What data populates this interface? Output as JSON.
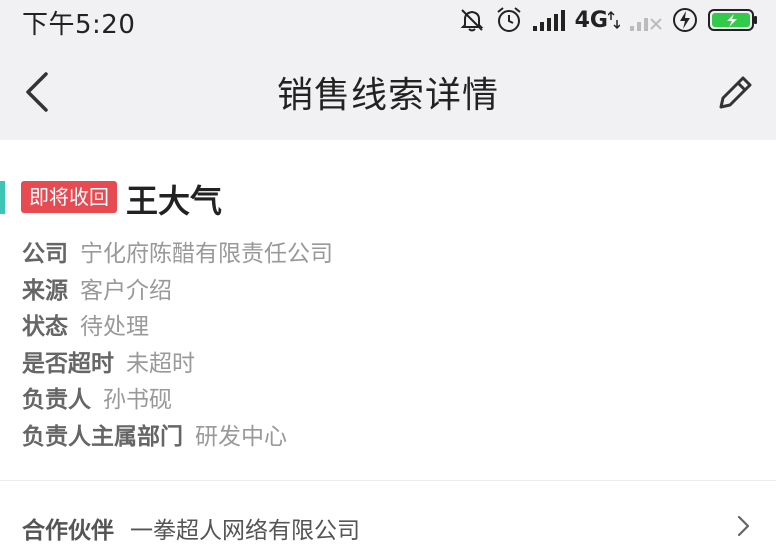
{
  "status_bar": {
    "time": "下午5:20",
    "network": "4G",
    "icons": [
      "bell-off-icon",
      "alarm-icon",
      "signal-icon",
      "network-4g-icon",
      "signal-weak-icon",
      "charging-icon",
      "battery-icon"
    ],
    "battery_color": "#33c94a"
  },
  "nav": {
    "title": "销售线索详情",
    "back_icon": "chevron-left-icon",
    "edit_icon": "pencil-icon"
  },
  "lead": {
    "tag": "即将收回",
    "tag_color": "#e84a52",
    "accent_color": "#3cc4b4",
    "name": "王大气",
    "fields": [
      {
        "label": "公司",
        "value": "宁化府陈醋有限责任公司"
      },
      {
        "label": "来源",
        "value": "客户介绍"
      },
      {
        "label": "状态",
        "value": "待处理"
      },
      {
        "label": "是否超时",
        "value": "未超时"
      },
      {
        "label": "负责人",
        "value": "孙书砚"
      },
      {
        "label": "负责人主属部门",
        "value": "研发中心"
      }
    ]
  },
  "partner": {
    "label": "合作伙伴",
    "value": "一拳超人网络有限公司",
    "chevron_icon": "chevron-right-icon"
  }
}
